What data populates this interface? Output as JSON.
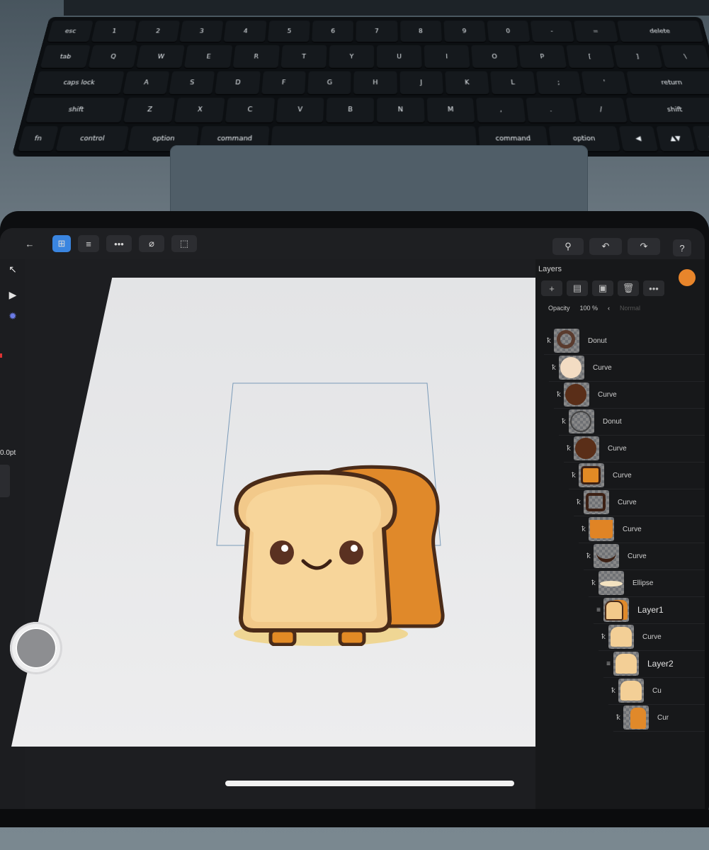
{
  "keyboard": {
    "rows": [
      [
        "esc",
        "1",
        "2",
        "3",
        "4",
        "5",
        "6",
        "7",
        "8",
        "9",
        "0",
        "-",
        "=",
        "delete"
      ],
      [
        "tab",
        "Q",
        "W",
        "E",
        "R",
        "T",
        "Y",
        "U",
        "I",
        "O",
        "P",
        "[",
        "]",
        "\\"
      ],
      [
        "caps lock",
        "A",
        "S",
        "D",
        "F",
        "G",
        "H",
        "J",
        "K",
        "L",
        ";",
        "'",
        "return"
      ],
      [
        "shift",
        "Z",
        "X",
        "C",
        "V",
        "B",
        "N",
        "M",
        ",",
        ".",
        "/",
        "shift"
      ],
      [
        "fn",
        "control",
        "option",
        "command",
        "",
        "command",
        "option",
        "◀",
        "▲▼",
        "▶"
      ]
    ]
  },
  "toolbar": {
    "back_label": "←",
    "grid_label": "⊞",
    "menu_label": "≡",
    "more_label": "•••",
    "snap_label": "⌀",
    "select_label": "⬚",
    "zoom_label": "⚲",
    "undo_label": "↶",
    "redo_label": "↷",
    "help_label": "?"
  },
  "left_tools": {
    "stroke_value": "0.0pt"
  },
  "layers_panel": {
    "title": "Layers",
    "opacity_label": "Opacity",
    "opacity_value": "100 %",
    "blend_mode": "Normal",
    "accent_color": "#e8852b",
    "layers": [
      {
        "name": "Donut",
        "thumb": "donut-light"
      },
      {
        "name": "Curve",
        "thumb": "cream-circle"
      },
      {
        "name": "Curve",
        "thumb": "brown-circle"
      },
      {
        "name": "Donut",
        "thumb": "donut"
      },
      {
        "name": "Curve",
        "thumb": "brown-circle"
      },
      {
        "name": "Curve",
        "thumb": "orange-square"
      },
      {
        "name": "Curve",
        "thumb": "outline-square"
      },
      {
        "name": "Curve",
        "thumb": "orange-block"
      },
      {
        "name": "Curve",
        "thumb": "smile"
      },
      {
        "name": "Ellipse",
        "thumb": "ellipse"
      },
      {
        "name": "Layer1",
        "thumb": "toast-full"
      },
      {
        "name": "Curve",
        "thumb": "toast-cream"
      },
      {
        "name": "Layer2",
        "thumb": "toast-cream"
      },
      {
        "name": "Cu",
        "thumb": "toast-cream"
      },
      {
        "name": "Cur",
        "thumb": "crust"
      }
    ]
  },
  "colors": {
    "crust": "#e0892a",
    "crust_dark": "#c96f1e",
    "bread": "#f2c98a",
    "outline": "#4a2b18",
    "eyes": "#5a3121",
    "shadow": "#f0d592",
    "legs": "#e28a25"
  }
}
